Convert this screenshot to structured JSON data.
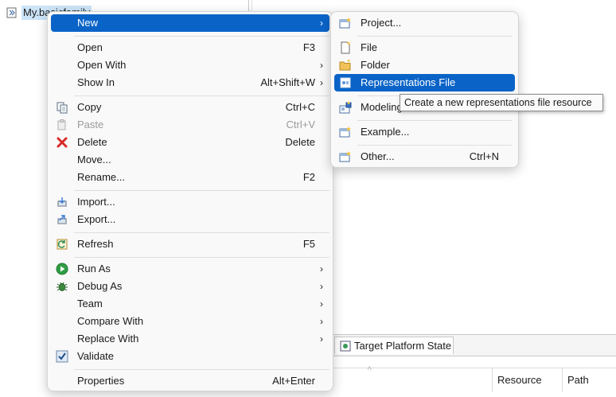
{
  "tree": {
    "item_label": "My.basicfamily"
  },
  "main_menu": {
    "new": "New",
    "open": "Open",
    "open_acc": "F3",
    "open_with": "Open With",
    "show_in": "Show In",
    "show_in_acc": "Alt+Shift+W",
    "copy": "Copy",
    "copy_acc": "Ctrl+C",
    "paste": "Paste",
    "paste_acc": "Ctrl+V",
    "delete": "Delete",
    "delete_acc": "Delete",
    "move": "Move...",
    "rename": "Rename...",
    "rename_acc": "F2",
    "import": "Import...",
    "export": "Export...",
    "refresh": "Refresh",
    "refresh_acc": "F5",
    "run_as": "Run As",
    "debug_as": "Debug As",
    "team": "Team",
    "compare_with": "Compare With",
    "replace_with": "Replace With",
    "validate": "Validate",
    "properties": "Properties",
    "properties_acc": "Alt+Enter",
    "submenu_arrow": "›"
  },
  "sub_menu": {
    "project": "Project...",
    "file": "File",
    "folder": "Folder",
    "representations_file": "Representations File",
    "modeling": "Modeling",
    "example": "Example...",
    "other": "Other...",
    "other_acc": "Ctrl+N"
  },
  "tooltip": {
    "text": "Create a new representations file resource"
  },
  "bottom": {
    "tab_label": "Target Platform State",
    "columns": [
      "Resource",
      "Path"
    ],
    "sort_indicator": "^"
  },
  "colors": {
    "highlight": "#0a64c8",
    "selection_bg": "#cce4f7"
  }
}
